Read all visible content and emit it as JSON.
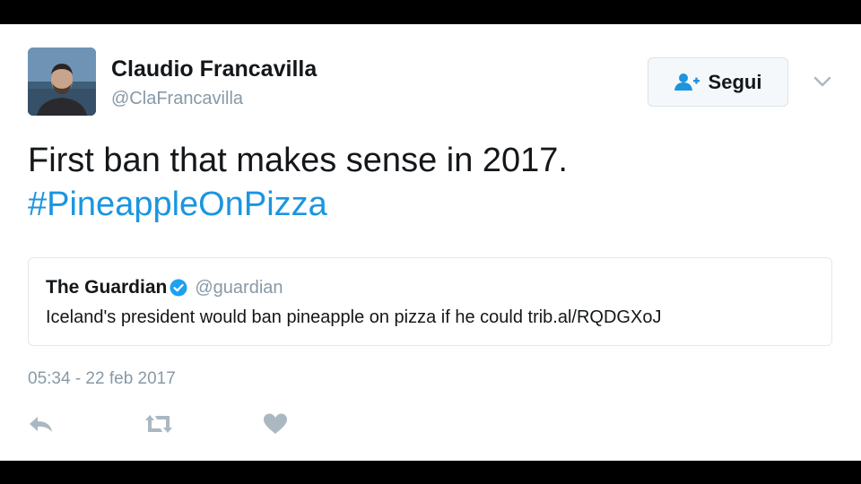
{
  "author": {
    "name": "Claudio Francavilla",
    "handle": "@ClaFrancavilla"
  },
  "follow_button": {
    "label": "Segui",
    "icon": "follow-user-icon"
  },
  "more_menu": {
    "icon": "chevron-down-icon"
  },
  "tweet": {
    "text": "First ban that makes sense in 2017.",
    "hashtag": "#PineappleOnPizza"
  },
  "quoted_tweet": {
    "name": "The Guardian",
    "handle": "@guardian",
    "verified": true,
    "text": "Iceland's president would ban pineapple on pizza if he could trib.al/RQDGXoJ"
  },
  "timestamp": "05:34 - 22 feb 2017",
  "actions": [
    {
      "icon": "reply-icon"
    },
    {
      "icon": "retweet-icon"
    },
    {
      "icon": "like-heart-icon"
    }
  ],
  "colors": {
    "link": "#1b95e0",
    "text": "#14171a",
    "muted": "#8899a6",
    "verified": "#1da1f2",
    "action_icons": "#aab8c2",
    "letterbox": "#000000"
  }
}
